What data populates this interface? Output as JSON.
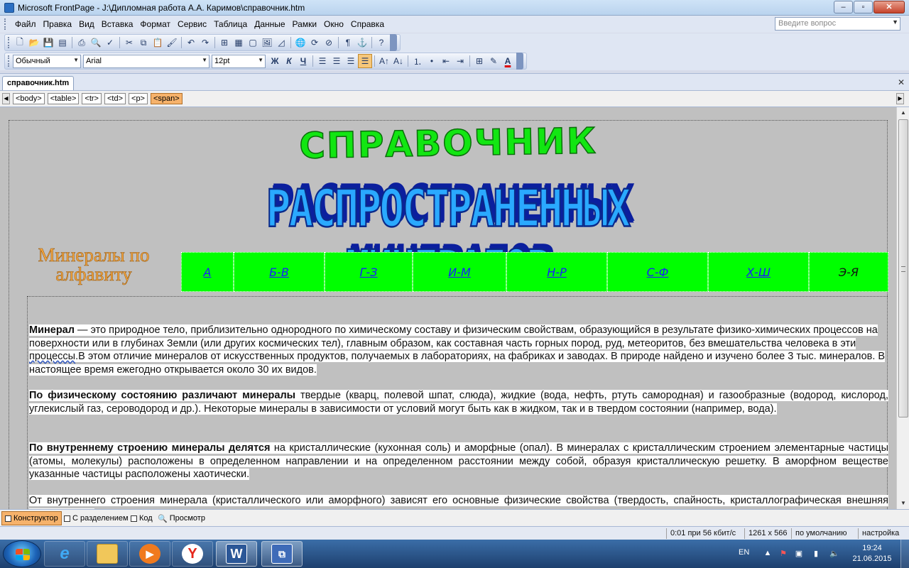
{
  "window": {
    "title": "Microsoft FrontPage - J:\\Дипломная работа А.А. Каримов\\справочник.htm",
    "minimize": "–",
    "maximize": "▫",
    "close": "✕"
  },
  "menu": [
    "Файл",
    "Правка",
    "Вид",
    "Вставка",
    "Формат",
    "Сервис",
    "Таблица",
    "Данные",
    "Рамки",
    "Окно",
    "Справка"
  ],
  "help_box": {
    "placeholder": "Введите вопрос"
  },
  "formatting": {
    "style": "Обычный",
    "font": "Arial",
    "size": "12pt",
    "bold": "Ж",
    "italic": "К",
    "underline": "Ч"
  },
  "document_tab": "справочник.htm",
  "tags": [
    "<body>",
    "<table>",
    "<tr>",
    "<td>",
    "<p>",
    "<span>"
  ],
  "page": {
    "headline1": "СПРАВОЧНИК",
    "headline2": "РАСПРОСТРАНЕННЫХ  МИНЕРАЛОВ",
    "nav_label": "Минералы по алфавиту",
    "nav_links": [
      "А",
      "Б-В",
      "Г-З",
      "И-М",
      "Н-Р",
      "С-Ф",
      "Х-Ш",
      "Э-Я"
    ],
    "paragraphs": [
      {
        "bold": "Минерал",
        "text1": " — это природное тело, приблизительно однородного по химическому составу и физическим свойствам, образующийся в результате физико-химических процессов на поверхности или в глубинах Земли (или других космических тел), главным образом, как составная часть горных пород, руд, метеоритов, без вмешательства человека в эти ",
        "link": "процессы",
        "text2": ".В этом отличие минералов от искусственных продуктов, получаемых в лабораториях, на фабриках и заводах. В природе найдено и изучено более 3 тыс. минералов. В настоящее время ежегодно открывается около 30 их видов."
      },
      {
        "bold": "По физическому состоянию различают минералы",
        "text1": " твердые (кварц, полевой шпат, слюда), жидкие (вода, нефть, ртуть самородная) и газообразные (водород, кислород, углекислый газ, сероводород и др.). Некоторые минералы в зависимости от условий могут быть как в жидком, так и в твердом состоянии (например, вода).",
        "link": "",
        "text2": ""
      },
      {
        "bold": "По внутреннему строению минералы делятся",
        "text1": " на кристаллические (кухонная соль) и аморфные (опал). В минералах с кристаллическим строением элементарные частицы (атомы, молекулы) расположены в определенном направлении и на определенном расстоянии между собой, образуя кристаллическую решетку. В аморфном веществе указанные частицы расположены хаотически.",
        "link": "",
        "text2": ""
      },
      {
        "bold": "",
        "text1": "От внутреннего строения минерала (кристаллического или аморфного) зависят его основные физические свойства (твердость, спайность, кристаллографическая внешняя форма и др.).",
        "link": "",
        "text2": ""
      }
    ]
  },
  "view_tabs": [
    "Конструктор",
    "С разделением",
    "Код",
    "Просмотр"
  ],
  "status": {
    "speed": "0:01 при 56 кбит/с",
    "size": "1261 x 566",
    "default": "по умолчанию",
    "custom": "настройка"
  },
  "taskbar": {
    "lang": "EN",
    "time": "19:24",
    "date": "21.06.2015"
  },
  "colors": {
    "nav_green": "#00ff00",
    "link_blue": "#1a1aff",
    "headline_green": "#12e612",
    "headline_blue": "#2aa9ff",
    "nav_label_orange": "#f5a742"
  }
}
